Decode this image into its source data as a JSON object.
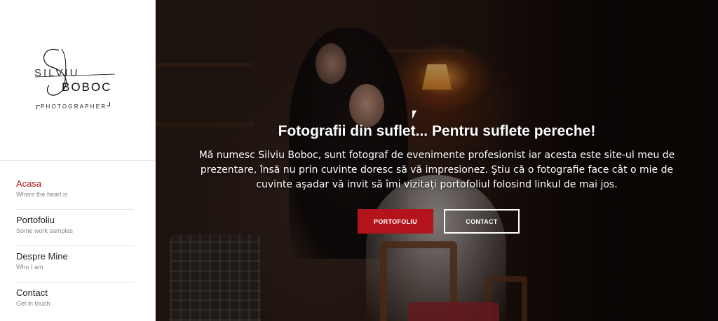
{
  "logo": {
    "first_name": "SILVIU",
    "last_name": "BOBOC",
    "tagline": "PHOTOGRAPHER"
  },
  "nav": {
    "items": [
      {
        "title": "Acasa",
        "subtitle": "Where the heart is",
        "active": true
      },
      {
        "title": "Portofoliu",
        "subtitle": "Some work samples",
        "active": false
      },
      {
        "title": "Despre Mine",
        "subtitle": "Who I am",
        "active": false
      },
      {
        "title": "Contact",
        "subtitle": "Get in touch",
        "active": false
      }
    ]
  },
  "hero": {
    "title": "Fotografii din suflet... Pentru suflete pereche!",
    "text": "Mă numesc Silviu Boboc, sunt fotograf de evenimente profesionist iar acesta este site-ul meu de prezentare, însă nu prin cuvinte doresc să vă impresionez. Ştiu că o fotografie face cât o mie de cuvinte aşadar vă invit să îmi vizitaţi portofoliul folosind linkul de mai jos.",
    "primary_button": "PORTOFOLIU",
    "secondary_button": "CONTACT"
  },
  "colors": {
    "accent": "#b3141c",
    "sidebar_bg": "#ffffff",
    "text": "#222222"
  }
}
